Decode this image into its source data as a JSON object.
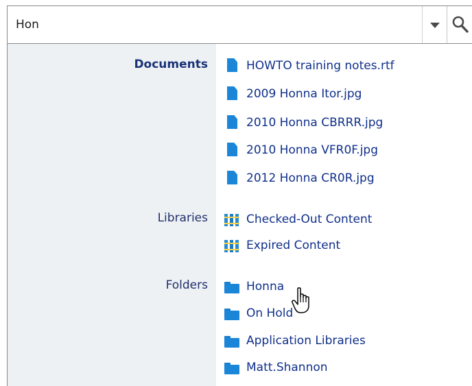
{
  "search": {
    "value": "Hon",
    "dropdown_icon": "chevron-down-icon",
    "search_icon": "search-icon"
  },
  "categories": {
    "documents": "Documents",
    "libraries": "Libraries",
    "folders": "Folders"
  },
  "documents": [
    {
      "label": "HOWTO training notes.rtf",
      "icon": "document-icon"
    },
    {
      "label": "2009 Honna Itor.jpg",
      "icon": "document-icon"
    },
    {
      "label": "2010 Honna CBRRR.jpg",
      "icon": "document-icon"
    },
    {
      "label": "2010 Honna VFR0F.jpg",
      "icon": "document-icon"
    },
    {
      "label": "2012 Honna CR0R.jpg",
      "icon": "document-icon"
    }
  ],
  "libraries": [
    {
      "label": "Checked-Out Content",
      "icon": "library-icon"
    },
    {
      "label": "Expired Content",
      "icon": "library-icon"
    }
  ],
  "folders": [
    {
      "label": "Honna",
      "icon": "folder-icon"
    },
    {
      "label": "On Hold",
      "icon": "folder-icon"
    },
    {
      "label": "Application Libraries",
      "icon": "folder-icon"
    },
    {
      "label": "Matt.Shannon",
      "icon": "folder-icon"
    }
  ],
  "colors": {
    "link": "#0f2f8a",
    "category_bg": "#eef1f4",
    "icon_blue": "#1b86d8"
  }
}
